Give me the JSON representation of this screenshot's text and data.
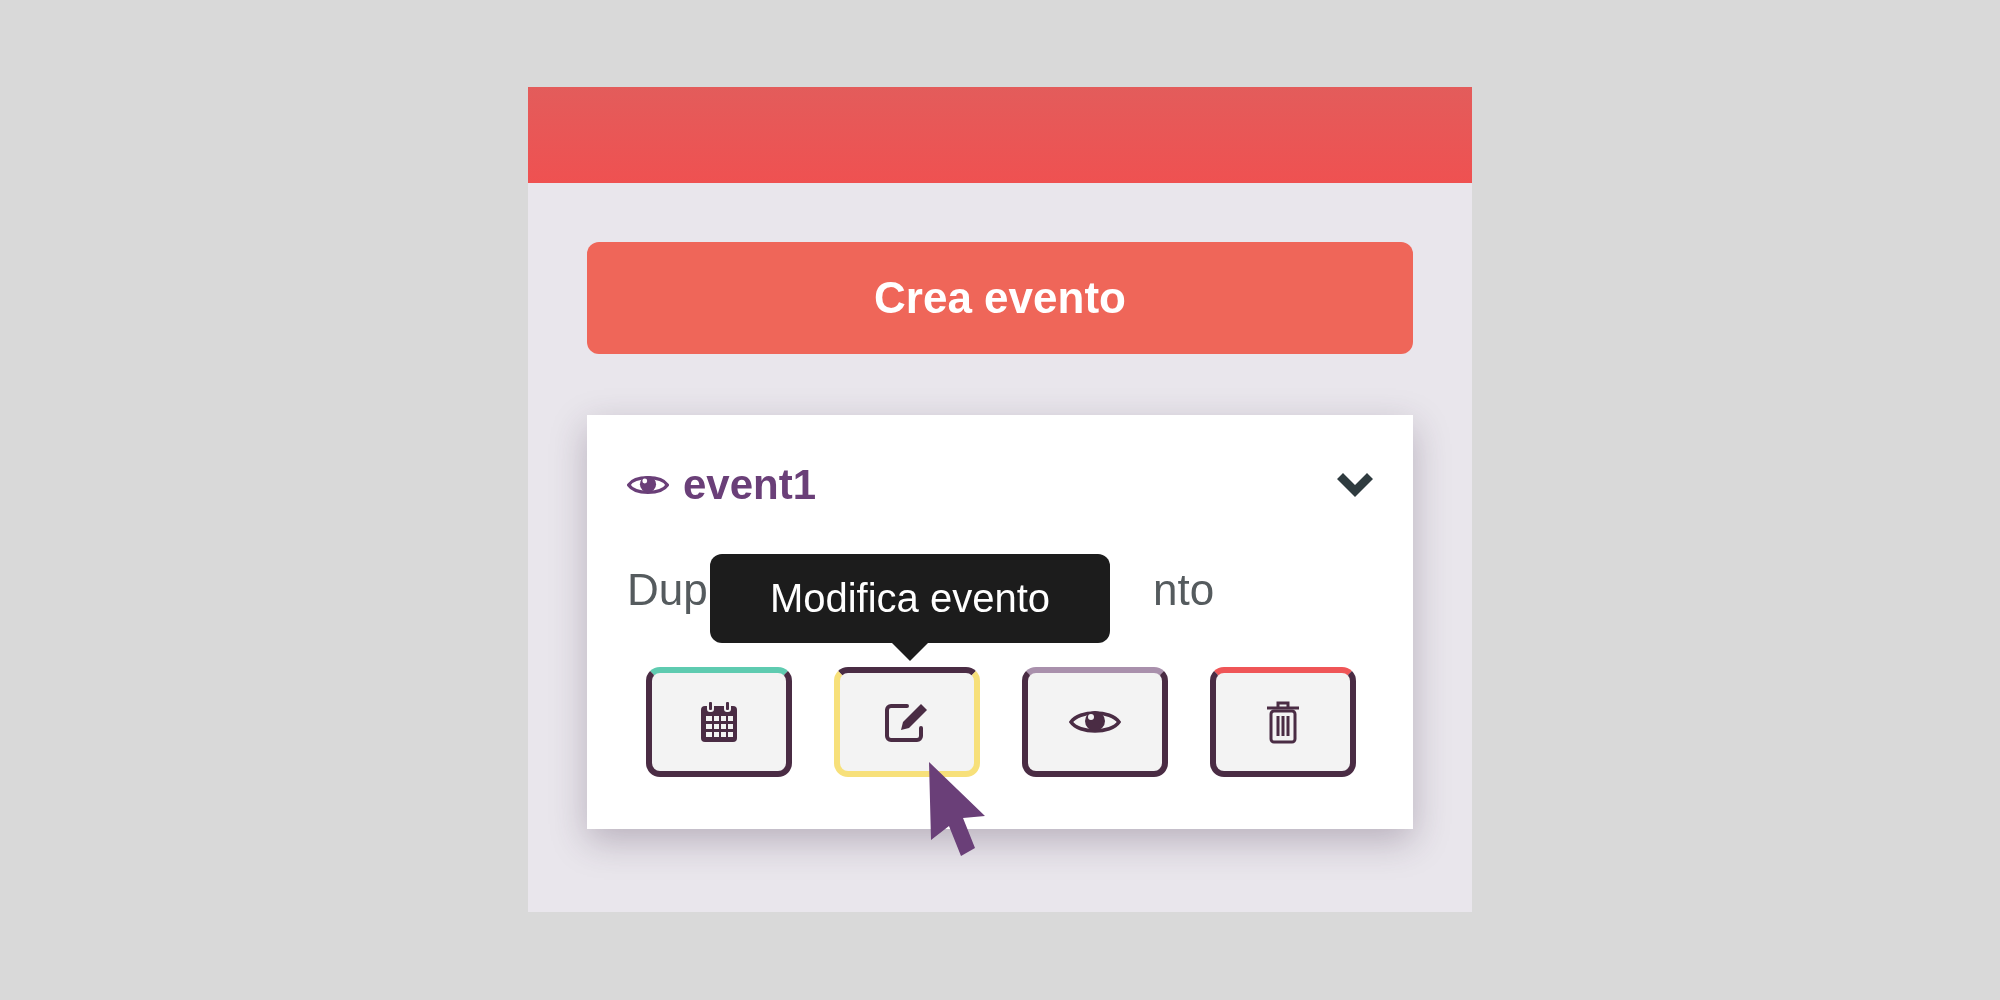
{
  "create_button": {
    "label": "Crea evento"
  },
  "event_card": {
    "title": "event1",
    "expanded": true,
    "description_parts": [
      "Dup",
      "nto"
    ],
    "tooltip": "Modifica evento",
    "actions": [
      {
        "kind": "calendar",
        "color": "#5ecbb0",
        "hovered": false
      },
      {
        "kind": "edit",
        "color": "#4a2c44",
        "hovered": true
      },
      {
        "kind": "view",
        "color": "#a990ac",
        "hovered": false
      },
      {
        "kind": "delete",
        "color": "#ef5557",
        "hovered": false
      }
    ]
  }
}
